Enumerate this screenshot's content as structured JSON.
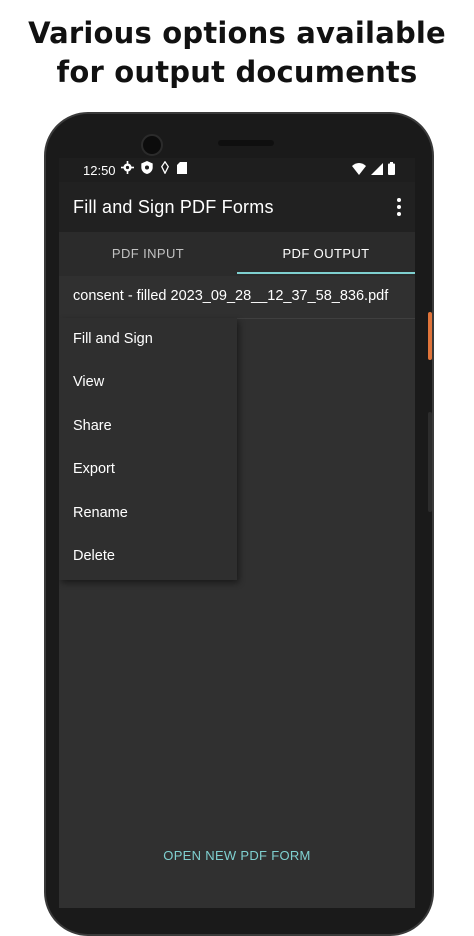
{
  "caption": {
    "line1": "Various options available",
    "line2": "for output documents"
  },
  "statusbar": {
    "time": "12:50",
    "icons": [
      "gear-icon",
      "shield-icon",
      "tag-icon",
      "sd-card-icon"
    ],
    "right_icons": [
      "wifi-icon",
      "signal-icon",
      "battery-icon"
    ]
  },
  "appbar": {
    "title": "Fill and Sign PDF Forms",
    "overflow_icon": "more-vert-icon"
  },
  "tabs": [
    {
      "label": "PDF INPUT",
      "selected": false
    },
    {
      "label": "PDF OUTPUT",
      "selected": true
    }
  ],
  "file": {
    "name": "consent - filled 2023_09_28__12_37_58_836.pdf"
  },
  "context_menu": {
    "items": [
      "Fill and Sign",
      "View",
      "Share",
      "Export",
      "Rename",
      "Delete"
    ]
  },
  "bottom": {
    "open_label": "OPEN NEW PDF FORM"
  },
  "colors": {
    "accent": "#7fd0d0",
    "appbar": "#212121",
    "screen_bg": "#303030"
  }
}
